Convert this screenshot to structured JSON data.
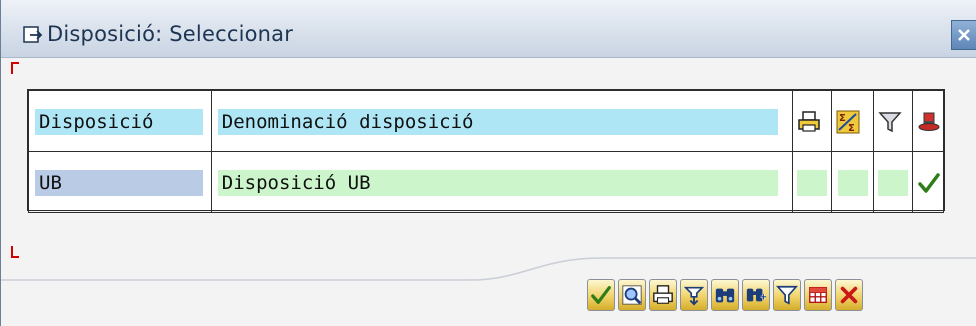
{
  "window": {
    "title": "Disposició: Seleccionar"
  },
  "grid": {
    "header": {
      "col1": "Disposició",
      "col2": "Denominació disposició"
    },
    "header_icons": [
      "print-icon",
      "sum-icon",
      "filter-icon",
      "hat-icon"
    ],
    "rows": [
      {
        "col1": "UB",
        "col2": "Disposició UB",
        "default_selected": true
      }
    ]
  },
  "toolbar": {
    "buttons": [
      "checkmark-icon",
      "search-icon",
      "print-icon",
      "sort-icon",
      "find-icon",
      "find-next-icon",
      "filter-icon",
      "table-settings-icon",
      "cancel-icon"
    ]
  },
  "colors": {
    "header_bg": "#aee6f5",
    "row_bg": "#ccf5cc",
    "key_bg": "#b9cbe5",
    "title_bar": "#d9e1ec",
    "accent_red": "#d40000"
  }
}
